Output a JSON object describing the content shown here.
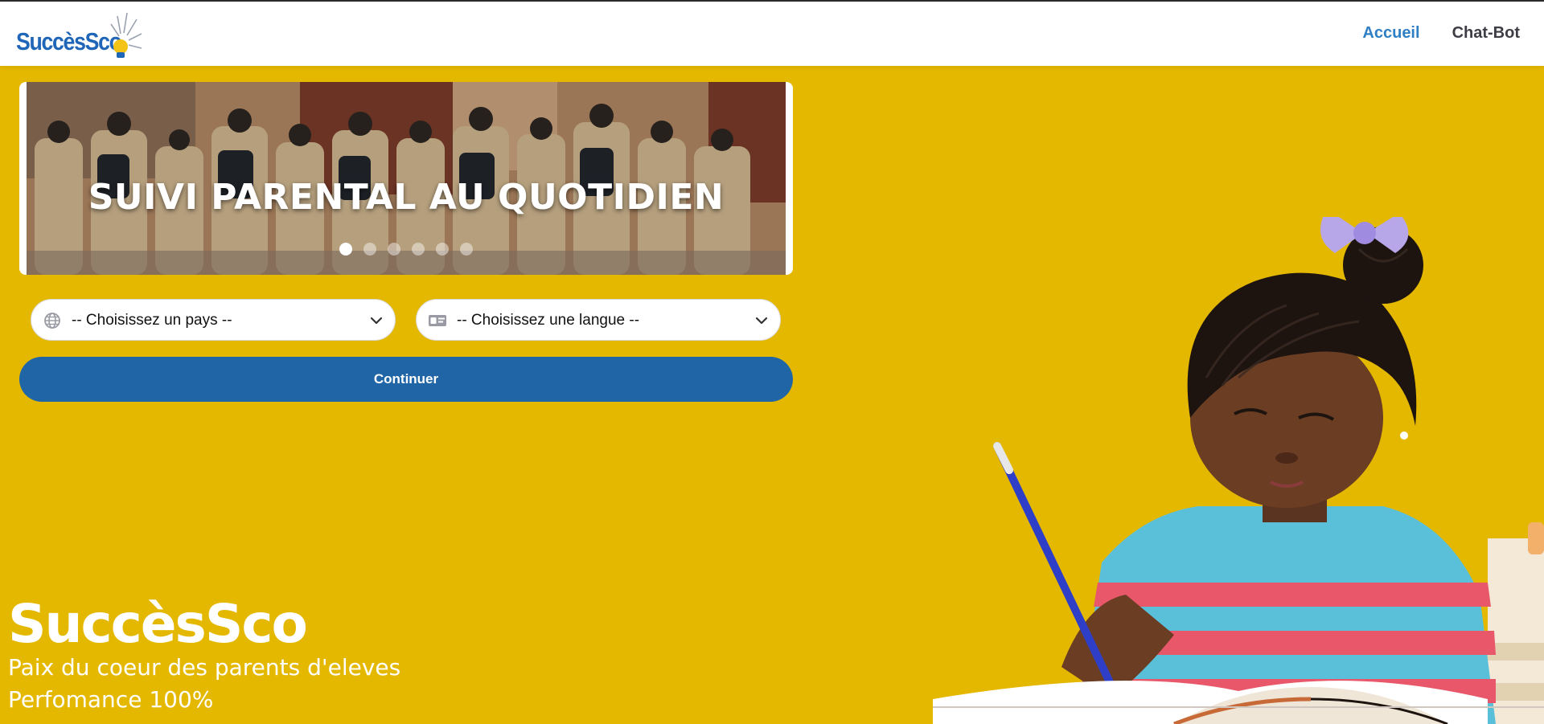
{
  "app": {
    "logo_text": "SuccèsSco"
  },
  "nav": {
    "links": [
      {
        "label": "Accueil",
        "active": true
      },
      {
        "label": "Chat-Bot",
        "active": false
      }
    ]
  },
  "carousel": {
    "slide_title": "SUIVI PARENTAL AU QUOTIDIEN",
    "dot_count": 6,
    "active_dot": 0
  },
  "form": {
    "country": {
      "value": "-- Choisissez un pays --",
      "icon": "globe-icon"
    },
    "language": {
      "value": "-- Choisissez une langue --",
      "icon": "id-card-icon"
    },
    "continue_label": "Continuer"
  },
  "hero": {
    "title": "SuccèsSco",
    "line1": "Paix du coeur des parents d'eleves",
    "line2": "Perfomance 100%"
  },
  "colors": {
    "background": "#e5b800",
    "primary": "#2065a6",
    "nav_active": "#2f7fc4",
    "nav_text": "#3d3d46"
  }
}
